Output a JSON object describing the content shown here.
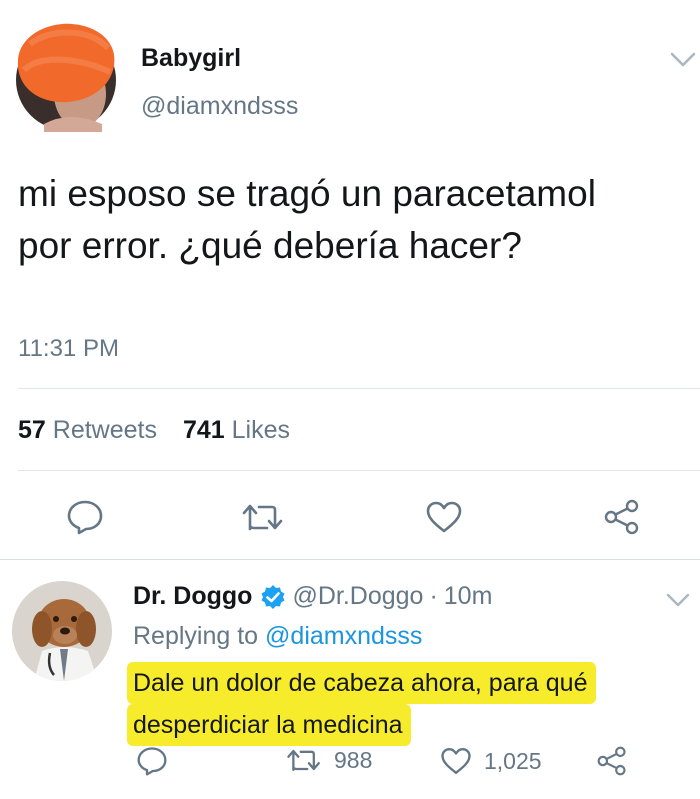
{
  "tweet": {
    "author_name": "Babygirl",
    "author_handle": "@diamxndsss",
    "text": "mi esposo se tragó un paracetamol por error. ¿qué debería hacer?",
    "time": "11:31 PM",
    "retweets_count": "57",
    "retweets_label": "Retweets",
    "likes_count": "741",
    "likes_label": "Likes",
    "actions": [
      "reply-icon",
      "retweet-icon",
      "like-icon",
      "share-icon"
    ]
  },
  "reply": {
    "author_name": "Dr. Doggo",
    "verified_icon": "verified-badge-icon",
    "author_handle": "@Dr.Doggo",
    "separator": "·",
    "age": "10m",
    "replying_prefix": "Replying to",
    "replying_handle": "@diamxndsss",
    "text_line1": "Dale un dolor de cabeza ahora, para qué",
    "text_line2": "desperdiciar la medicina",
    "retweet_count": "988",
    "like_count": "1,025"
  },
  "colors": {
    "text": "#14171a",
    "secondary": "#657786",
    "link": "#1b95e0",
    "highlight": "#f7ec2b",
    "avatar_scribble": "#f26a2b"
  }
}
